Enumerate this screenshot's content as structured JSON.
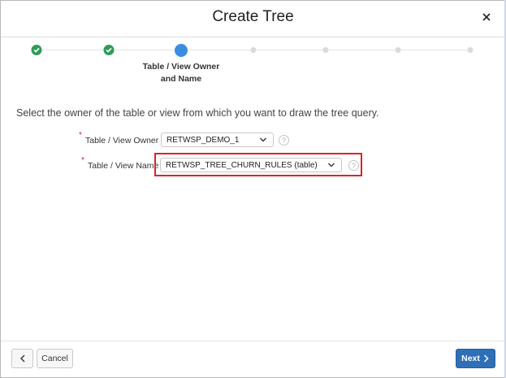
{
  "dialog": {
    "title": "Create Tree",
    "close_icon": "close-icon"
  },
  "wizard": {
    "steps": [
      {
        "status": "complete"
      },
      {
        "status": "complete"
      },
      {
        "status": "current",
        "label_line1": "Table / View Owner",
        "label_line2": "and Name"
      },
      {
        "status": "pending"
      },
      {
        "status": "pending"
      },
      {
        "status": "pending"
      },
      {
        "status": "pending"
      }
    ],
    "colors": {
      "complete": "#2e9d5a",
      "current": "#3a8de0",
      "pending": "#dadada"
    }
  },
  "instructions": "Select the owner of the table or view from which you want to draw the tree query.",
  "form": {
    "owner": {
      "required_mark": "*",
      "label": "Table / View Owner",
      "value": "RETWSP_DEMO_1",
      "help": "?"
    },
    "name": {
      "required_mark": "*",
      "label": "Table / View Name",
      "value": "RETWSP_TREE_CHURN_RULES (table)",
      "help": "?"
    }
  },
  "highlight_color": "#d6262e",
  "footer": {
    "back_icon": "chevron-left-icon",
    "cancel_label": "Cancel",
    "next_label": "Next",
    "next_icon": "chevron-right-icon",
    "next_color": "#2e6fb7"
  }
}
